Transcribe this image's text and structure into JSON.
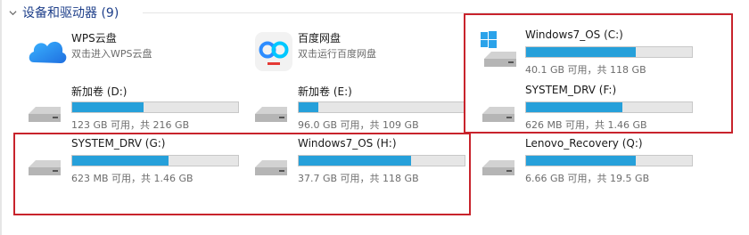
{
  "section": {
    "title": "设备和驱动器 (9)"
  },
  "apps": [
    {
      "name": "WPS云盘",
      "desc": "双击进入WPS云盘",
      "icon": "cloud-icon"
    },
    {
      "name": "百度网盘",
      "desc": "双击运行百度网盘",
      "icon": "baidu-netdisk-icon"
    }
  ],
  "drives": [
    {
      "name": "新加卷 (D:)",
      "cap": "123 GB 可用，共 216 GB",
      "used": 0.43,
      "icon": "drive-icon"
    },
    {
      "name": "新加卷 (E:)",
      "cap": "96.0 GB 可用，共 109 GB",
      "used": 0.12,
      "icon": "drive-icon"
    },
    {
      "name": "Windows7_OS (C:)",
      "cap": "40.1 GB 可用，共 118 GB",
      "used": 0.66,
      "icon": "windows-drive-icon"
    },
    {
      "name": "SYSTEM_DRV (F:)",
      "cap": "626 MB 可用，共 1.46 GB",
      "used": 0.58,
      "icon": "drive-icon"
    },
    {
      "name": "SYSTEM_DRV (G:)",
      "cap": "623 MB 可用，共 1.46 GB",
      "used": 0.58,
      "icon": "drive-icon"
    },
    {
      "name": "Windows7_OS (H:)",
      "cap": "37.7 GB 可用，共 118 GB",
      "used": 0.68,
      "icon": "drive-icon"
    },
    {
      "name": "Lenovo_Recovery (Q:)",
      "cap": "6.66 GB 可用，共 19.5 GB",
      "used": 0.66,
      "icon": "drive-icon"
    }
  ],
  "colors": {
    "bar_fill": "#26a0da",
    "highlight": "#c8232c",
    "header": "#1e3f8a"
  }
}
